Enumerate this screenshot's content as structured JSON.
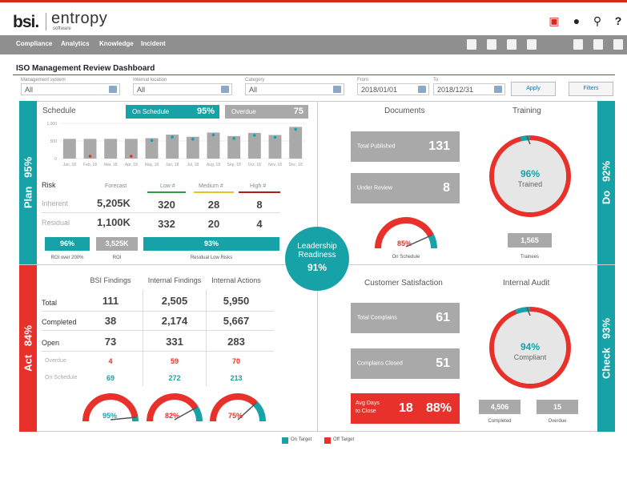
{
  "app": {
    "logo_bsi": "bsi.",
    "logo_entropy": "entropy",
    "logo_sub": "software"
  },
  "menu": [
    "Compliance",
    "Analytics",
    "Knowledge",
    "Incident"
  ],
  "page_title": "ISO Management Review Dashboard",
  "filters": {
    "management_system": {
      "label": "Management system",
      "value": "All"
    },
    "internal_location": {
      "label": "Internal location",
      "value": "All"
    },
    "category": {
      "label": "Category",
      "value": "All"
    },
    "from": {
      "label": "From",
      "value": "2018/01/01"
    },
    "to": {
      "label": "To",
      "value": "2018/12/31"
    },
    "apply": "Apply",
    "filters_btn": "Filters"
  },
  "plan": {
    "side_label": "Plan",
    "side_pct": "95%",
    "schedule_title": "Schedule",
    "on_schedule_label": "On Schedule",
    "on_schedule_value": "95%",
    "overdue_label": "Overdue",
    "overdue_value": "75",
    "risk": {
      "title": "Risk",
      "forecast_label": "Forecast",
      "low_label": "Low #",
      "medium_label": "Medium #",
      "high_label": "High #",
      "inherent_label": "Inherent",
      "inherent_forecast": "5,205K",
      "inherent_low": "320",
      "inherent_medium": "28",
      "inherent_high": "8",
      "residual_label": "Residual",
      "residual_forecast": "1,100K",
      "residual_low": "332",
      "residual_medium": "20",
      "residual_high": "4",
      "roi_pct": "96%",
      "roi_value": "3,525K",
      "low_risk_pct": "93%",
      "roi_over_label": "ROI over 200%",
      "roi_label": "ROI",
      "residual_low_label": "Residual Low Risks"
    }
  },
  "chart_data": {
    "type": "bar",
    "categories": [
      "Jan, 18",
      "Feb, 18",
      "Mar, 18",
      "Apr, 18",
      "May, 18",
      "Jun, 18",
      "Jul, 18",
      "Aug, 18",
      "Sep, 18",
      "Oct, 18",
      "Nov, 18",
      "Dec, 18"
    ],
    "series": [
      {
        "values": [
          560,
          560,
          560,
          560,
          580,
          680,
          620,
          740,
          640,
          730,
          670,
          900
        ]
      }
    ],
    "markers": [
      {
        "x": "Feb, 18",
        "color": "#e8312a"
      },
      {
        "x": "Apr, 18",
        "color": "#e8312a"
      },
      {
        "x": "May, 18",
        "color": "#17a2a8"
      },
      {
        "x": "Jun, 18",
        "color": "#17a2a8"
      },
      {
        "x": "Jul, 18",
        "color": "#17a2a8"
      },
      {
        "x": "Aug, 18",
        "color": "#17a2a8"
      },
      {
        "x": "Sep, 18",
        "color": "#17a2a8"
      },
      {
        "x": "Oct, 18",
        "color": "#17a2a8"
      },
      {
        "x": "Nov, 18",
        "color": "#17a2a8"
      },
      {
        "x": "Dec, 18",
        "color": "#17a2a8"
      }
    ],
    "ylim": [
      0,
      1000
    ],
    "yticks": [
      "1,000",
      "500",
      "0"
    ]
  },
  "do": {
    "side_label": "Do",
    "side_pct": "92%",
    "documents_title": "Documents",
    "total_published_label": "Total Published",
    "total_published": "131",
    "under_review_label": "Under Review",
    "under_review": "8",
    "gauge_pct": "85%",
    "gauge_label": "On Schedule",
    "gauge_value": 0.85,
    "training_title": "Training",
    "trained_pct": "96%",
    "trained_label": "Trained",
    "trained_value": 0.96,
    "trainees_value": "1,565",
    "trainees_label": "Trainees"
  },
  "center": {
    "line1": "Leadership",
    "line2": "Readiness",
    "pct": "91%"
  },
  "act": {
    "side_label": "Act",
    "side_pct": "84%",
    "col_bsi": "BSI Findings",
    "col_internal": "Internal Findings",
    "col_actions": "Internal Actions",
    "rows": [
      {
        "label": "Total",
        "bsi": "111",
        "internal": "2,505",
        "actions": "5,950"
      },
      {
        "label": "Completed",
        "bsi": "38",
        "internal": "2,174",
        "actions": "5,667"
      },
      {
        "label": "Open",
        "bsi": "73",
        "internal": "331",
        "actions": "283"
      }
    ],
    "overdue_label": "Overdue",
    "overdue": {
      "bsi": "4",
      "internal": "59",
      "actions": "70"
    },
    "onschedule_label": "On Schedule",
    "onschedule": {
      "bsi": "69",
      "internal": "272",
      "actions": "213"
    },
    "gauges": [
      {
        "pct": "95%",
        "value": 0.95
      },
      {
        "pct": "82%",
        "value": 0.82
      },
      {
        "pct": "75%",
        "value": 0.75
      }
    ]
  },
  "check": {
    "side_label": "Check",
    "side_pct": "93%",
    "cs_title": "Customer Satisfaction",
    "total_complains_label": "Total Complains",
    "total_complains": "61",
    "complains_closed_label": "Complains Closed",
    "complains_closed": "51",
    "avg_days_label1": "Avg Days",
    "avg_days_label2": "to Close",
    "avg_days": "18",
    "avg_days_pct": "88%",
    "audit_title": "Internal Audit",
    "compliant_pct": "94%",
    "compliant_label": "Compliant",
    "compliant_value": 0.94,
    "completed_value": "4,506",
    "completed_label": "Completed",
    "overdue_value": "15",
    "overdue_label": "Overdue"
  },
  "legend": {
    "on_target": "On Target",
    "off_target": "Off Target"
  },
  "colors": {
    "teal": "#17a2a8",
    "red": "#e8312a",
    "grey": "#a9a9a9",
    "brand_red": "#d9261c"
  }
}
